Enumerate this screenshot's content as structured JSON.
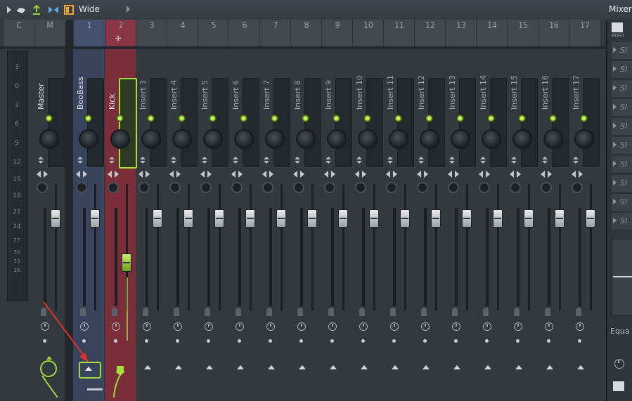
{
  "toolbar": {
    "preset_label": "Wide",
    "icons": [
      "play-arrow-icon",
      "mouse-snap-icon",
      "tool-icon",
      "wide-icon",
      "checkbox-icon"
    ]
  },
  "panel": {
    "title": "Mixer",
    "post_label": "POST",
    "slot_text": "Sl",
    "eq_label": "Equa"
  },
  "tracks": [
    {
      "num": "C",
      "name": ""
    },
    {
      "num": "M",
      "name": "Master"
    },
    {
      "num": "1",
      "name": "BooBass"
    },
    {
      "num": "2",
      "name": "Kick"
    },
    {
      "num": "3",
      "name": "Insert 3"
    },
    {
      "num": "4",
      "name": "Insert 4"
    },
    {
      "num": "5",
      "name": "Insert 5"
    },
    {
      "num": "6",
      "name": "Insert 6"
    },
    {
      "num": "7",
      "name": "Insert 7"
    },
    {
      "num": "8",
      "name": "Insert 8"
    },
    {
      "num": "9",
      "name": "Insert 9"
    },
    {
      "num": "10",
      "name": "Insert 10"
    },
    {
      "num": "11",
      "name": "Insert 11"
    },
    {
      "num": "12",
      "name": "Insert 12"
    },
    {
      "num": "13",
      "name": "Insert 13"
    },
    {
      "num": "14",
      "name": "Insert 14"
    },
    {
      "num": "15",
      "name": "Insert 15"
    },
    {
      "num": "16",
      "name": "Insert 16"
    },
    {
      "num": "17",
      "name": "Insert 17"
    }
  ],
  "db_scale": [
    "3",
    "0",
    "3",
    "6",
    "9",
    "12",
    "15",
    "18",
    "21",
    "24",
    "27",
    "30",
    "33",
    "36"
  ],
  "colors": {
    "accent": "#a6dc3c",
    "selected_track": "#8a2f3c",
    "track_1_tint": "#3a4a6a"
  }
}
